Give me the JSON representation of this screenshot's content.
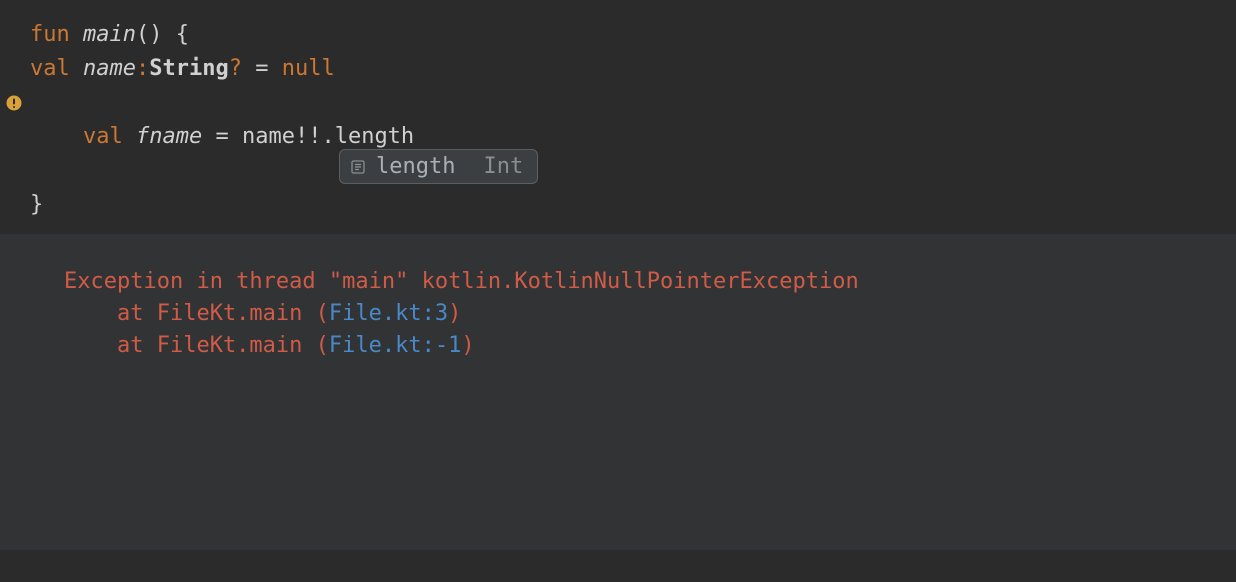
{
  "code": {
    "line1": {
      "kw_fun": "fun",
      "fn_name": "main",
      "parens": "()",
      "brace_open": "{"
    },
    "line2": {
      "kw_val": "val",
      "var_name": "name",
      "colon": ":",
      "type": "String",
      "question": "?",
      "eq": "=",
      "null_kw": "null"
    },
    "line3": {
      "kw_val": "val",
      "var_name": "fname",
      "eq": "=",
      "rhs_name": "name",
      "bangbang_dot": "!!.",
      "member": "length"
    },
    "close_brace": "}"
  },
  "completion": {
    "name": "length",
    "type": "Int"
  },
  "console": {
    "line1": "Exception in thread \"main\" kotlin.KotlinNullPointerException",
    "line2_prefix": "    at FileKt.main (",
    "line2_link": "File.kt:3",
    "line2_suffix": ")",
    "line3_prefix": "    at FileKt.main (",
    "line3_link": "File.kt:-1",
    "line3_suffix": ")"
  },
  "icons": {
    "warning": "warning-icon",
    "field": "field-icon"
  }
}
